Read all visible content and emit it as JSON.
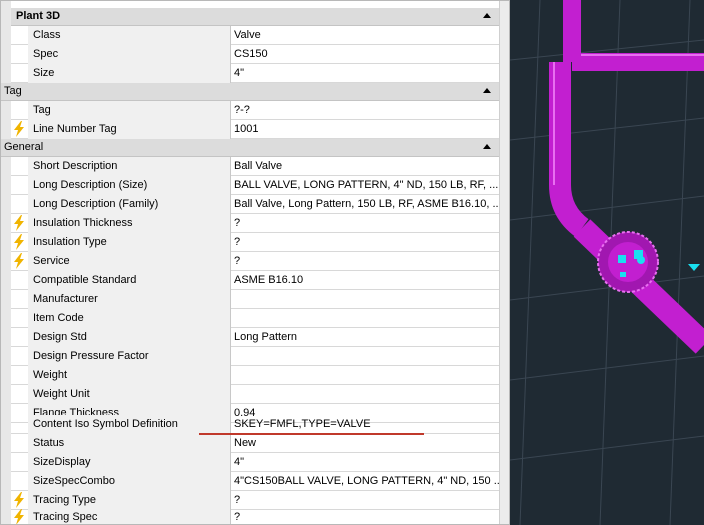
{
  "properties": {
    "categories": [
      {
        "label": "Plant 3D"
      },
      {
        "label": "Tag"
      },
      {
        "label": "General"
      }
    ],
    "rows": [
      {
        "name": "Class",
        "value": "Valve",
        "dynamic": false
      },
      {
        "name": "Spec",
        "value": "CS150",
        "dynamic": false
      },
      {
        "name": "Size",
        "value": "4\"",
        "dynamic": false
      },
      {
        "name": "Tag",
        "value": "?-?",
        "dynamic": false
      },
      {
        "name": "Line Number Tag",
        "value": "1001",
        "dynamic": true
      },
      {
        "name": "Short Description",
        "value": "Ball Valve",
        "dynamic": false
      },
      {
        "name": "Long Description (Size)",
        "value": "BALL VALVE, LONG PATTERN, 4\" ND, 150 LB, RF, ...",
        "dynamic": false
      },
      {
        "name": "Long Description (Family)",
        "value": "Ball Valve, Long Pattern, 150 LB, RF, ASME B16.10, ...",
        "dynamic": false
      },
      {
        "name": "Insulation Thickness",
        "value": "?",
        "dynamic": true
      },
      {
        "name": "Insulation Type",
        "value": "?",
        "dynamic": true
      },
      {
        "name": "Service",
        "value": "?",
        "dynamic": true
      },
      {
        "name": "Compatible Standard",
        "value": "ASME B16.10",
        "dynamic": false
      },
      {
        "name": "Manufacturer",
        "value": "",
        "dynamic": false
      },
      {
        "name": "Item Code",
        "value": "",
        "dynamic": false
      },
      {
        "name": "Design Std",
        "value": "Long Pattern",
        "dynamic": false
      },
      {
        "name": "Design Pressure Factor",
        "value": "",
        "dynamic": false
      },
      {
        "name": "Weight",
        "value": "",
        "dynamic": false
      },
      {
        "name": "Weight Unit",
        "value": "",
        "dynamic": false
      },
      {
        "name": "Flange Thickness",
        "value": "0.94",
        "dynamic": false
      },
      {
        "name": "Content Iso Symbol Definition",
        "value": "SKEY=FMFL,TYPE=VALVE",
        "dynamic": false
      },
      {
        "name": "Status",
        "value": "New",
        "dynamic": false
      },
      {
        "name": "SizeDisplay",
        "value": "4\"",
        "dynamic": false
      },
      {
        "name": "SizeSpecCombo",
        "value": "4\"CS150BALL VALVE, LONG PATTERN, 4\" ND, 150 ...",
        "dynamic": false
      },
      {
        "name": "Tracing Type",
        "value": "?",
        "dynamic": true
      },
      {
        "name": "Tracing Spec",
        "value": "?",
        "dynamic": true
      }
    ]
  },
  "icons": {
    "collapse": "chevron-up-icon",
    "dynamic_property": "lightning-bolt-icon"
  },
  "colors": {
    "pipe": "#c21fd0",
    "viewport_bg": "#1f2a33",
    "highlight_underline": "#c0392b",
    "bolt": "#f0b400"
  }
}
